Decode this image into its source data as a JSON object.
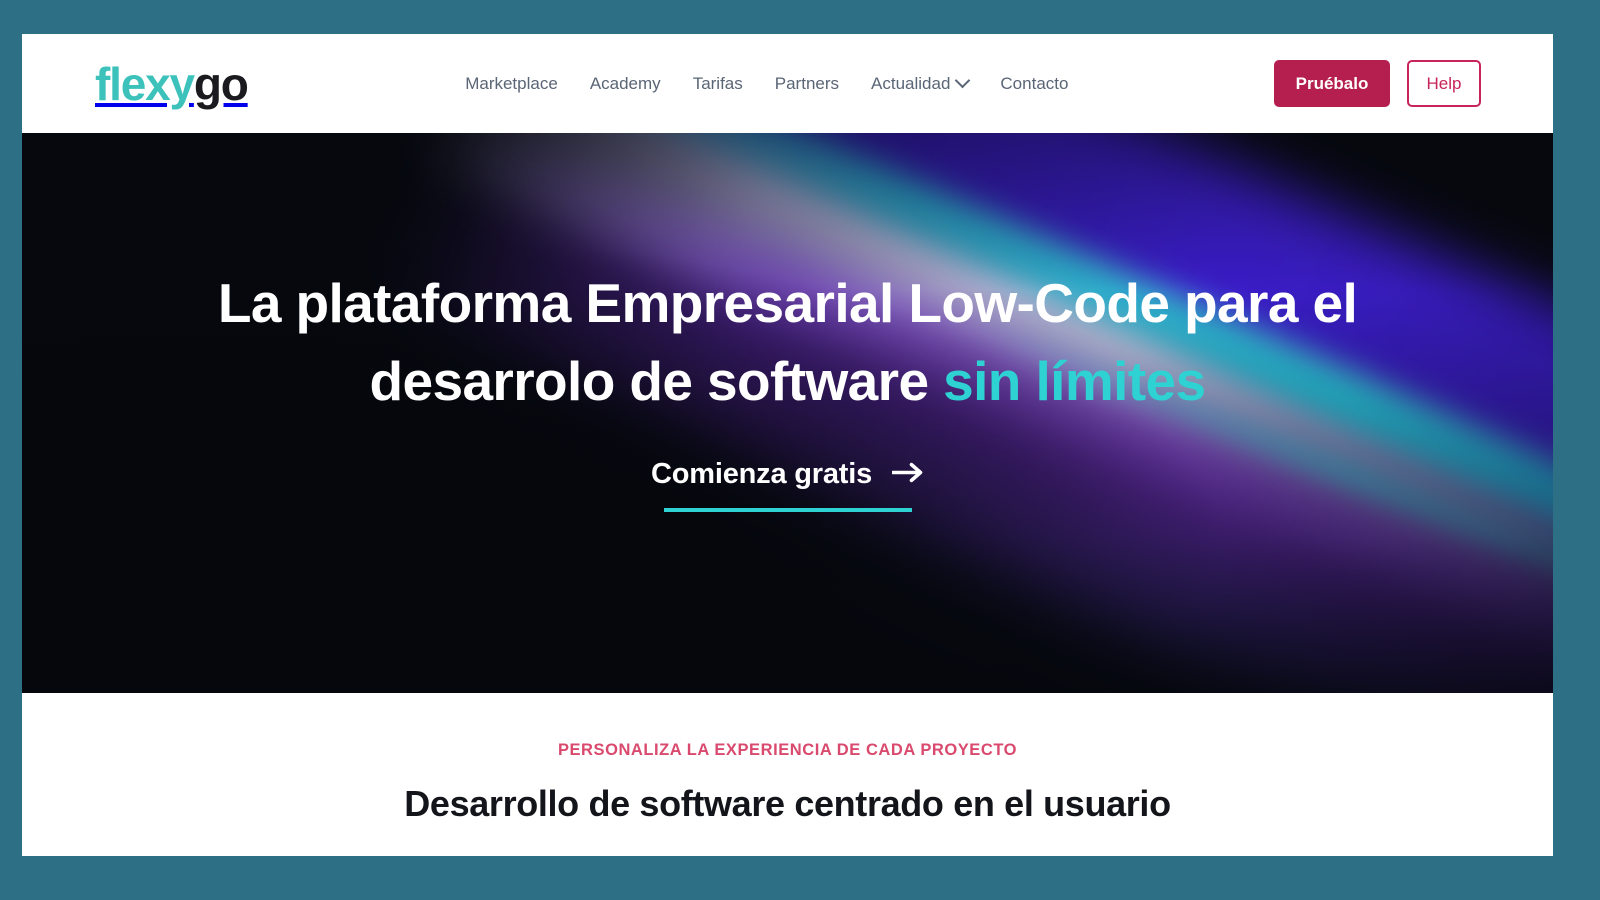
{
  "theme": {
    "frame_color": "#2d7085",
    "brand_teal": "#3cc2bb",
    "accent_cyan": "#2fd2d2",
    "brand_crimson": "#b51f4f",
    "outline_crimson": "#c72459",
    "eyebrow_pink": "#d94a6e",
    "nav_text": "#5a6576"
  },
  "header": {
    "logo": {
      "part1": "flexy",
      "part2": "go"
    },
    "nav": [
      {
        "label": "Marketplace",
        "has_chevron": false
      },
      {
        "label": "Academy",
        "has_chevron": false
      },
      {
        "label": "Tarifas",
        "has_chevron": false
      },
      {
        "label": "Partners",
        "has_chevron": false
      },
      {
        "label": "Actualidad",
        "has_chevron": true
      },
      {
        "label": "Contacto",
        "has_chevron": false
      }
    ],
    "actions": {
      "primary_label": "Pruébalo",
      "secondary_label": "Help"
    }
  },
  "hero": {
    "title_line1": "La plataforma Empresarial Low-Code para el",
    "title_line2_white": "desarrolo de software",
    "title_line2_accent": "sin límites",
    "cta_label": "Comienza gratis",
    "cta_icon": "arrow-right-icon"
  },
  "intro_section": {
    "eyebrow": "PERSONALIZA LA EXPERIENCIA DE CADA PROYECTO",
    "heading": "Desarrollo de software centrado en el usuario"
  }
}
